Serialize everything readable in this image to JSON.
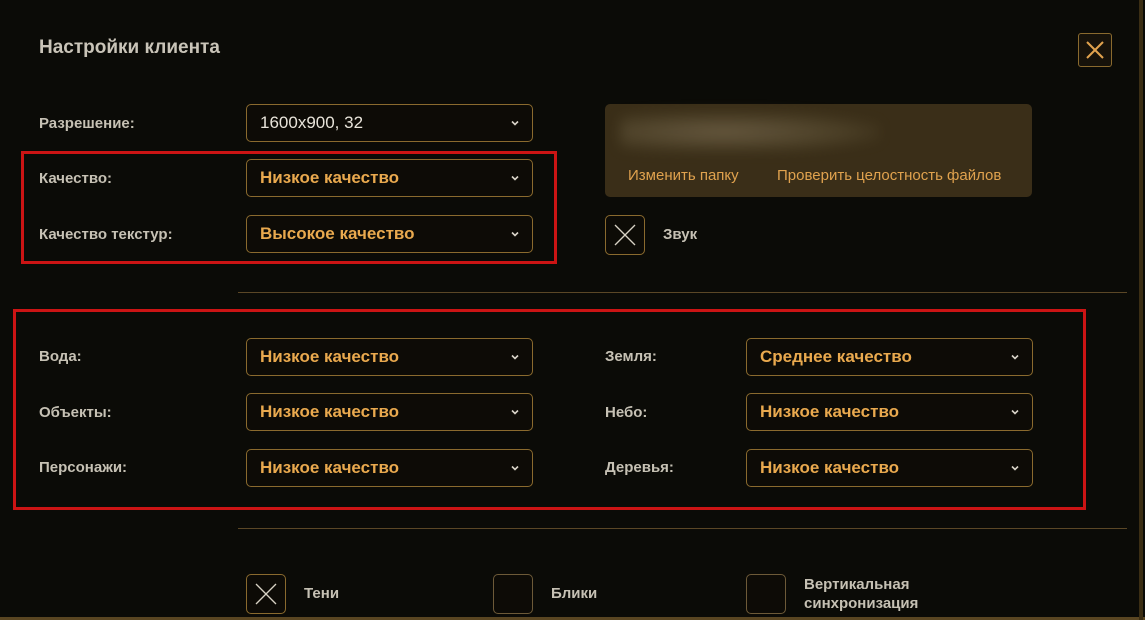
{
  "window": {
    "title": "Настройки клиента"
  },
  "resolution": {
    "label": "Разрешение:",
    "value": "1600x900, 32"
  },
  "quality": {
    "label": "Качество:",
    "value": "Низкое качество"
  },
  "texture_quality": {
    "label": "Качество текстур:",
    "value": "Высокое качество"
  },
  "folder": {
    "change_folder": "Изменить папку",
    "verify_files": "Проверить целостность файлов"
  },
  "sound": {
    "label": "Звук",
    "checked": true
  },
  "detail": {
    "water": {
      "label": "Вода:",
      "value": "Низкое качество"
    },
    "objects": {
      "label": "Объекты:",
      "value": "Низкое качество"
    },
    "characters": {
      "label": "Персонажи:",
      "value": "Низкое качество"
    },
    "ground": {
      "label": "Земля:",
      "value": "Среднее качество"
    },
    "sky": {
      "label": "Небо:",
      "value": "Низкое качество"
    },
    "trees": {
      "label": "Деревья:",
      "value": "Низкое качество"
    }
  },
  "toggles": {
    "shadows": {
      "label": "Тени",
      "checked": true
    },
    "glare": {
      "label": "Блики",
      "checked": false
    },
    "vsync": {
      "label_line1": "Вертикальная",
      "label_line2": "синхронизация",
      "checked": false
    }
  },
  "colors": {
    "background": "#0b0b07",
    "accent": "#e9a94e",
    "border": "#8a6a2e",
    "highlight": "#cc1414"
  }
}
